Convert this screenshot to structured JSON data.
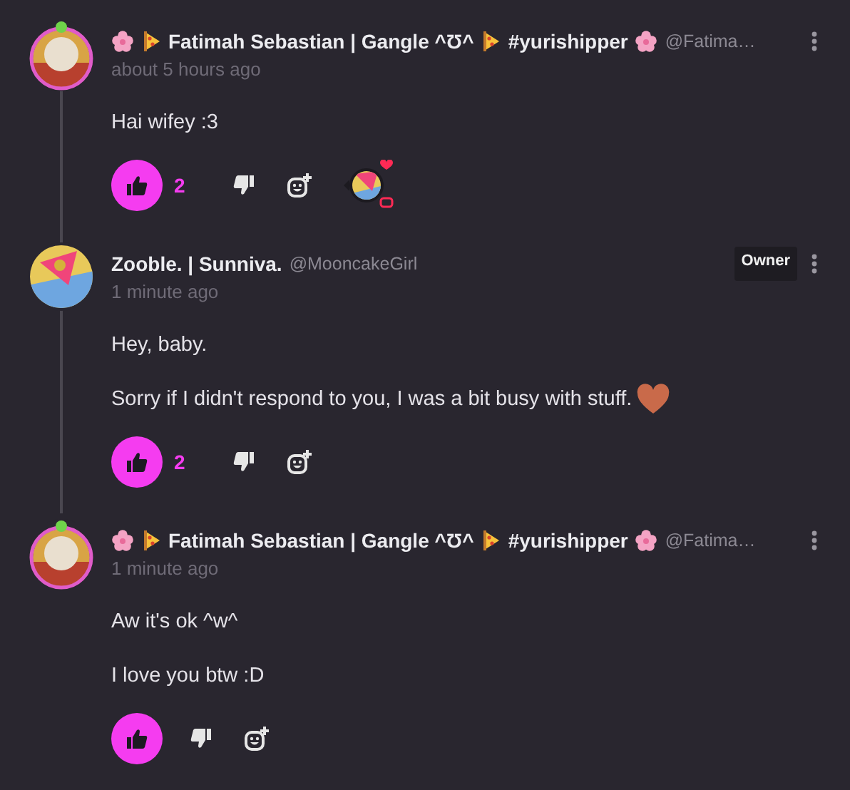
{
  "comments": [
    {
      "author": {
        "name": "Fatimah Sebastian | Gangle ^Ʊ^",
        "tag": "#yurishipper",
        "handle": "@Fatima…",
        "decorated": true,
        "avatar_frame": true
      },
      "time": "about 5 hours ago",
      "paragraphs": [
        {
          "text": "Hai wifey :3",
          "ends_with_heart": false
        }
      ],
      "liked": true,
      "likes": "2",
      "creator_hearted": true
    },
    {
      "author": {
        "name": "Zooble. | Sunniva.",
        "handle": "@MooncakeGirl",
        "decorated": false,
        "avatar_frame": false
      },
      "time": "1 minute ago",
      "owner_badge": "Owner",
      "paragraphs": [
        {
          "text": "Hey, baby.",
          "ends_with_heart": false
        },
        {
          "text": "Sorry if I didn't respond to you, I was a bit busy with stuff.",
          "ends_with_heart": true
        }
      ],
      "liked": true,
      "likes": "2",
      "creator_hearted": false
    },
    {
      "author": {
        "name": "Fatimah Sebastian | Gangle ^Ʊ^",
        "tag": "#yurishipper",
        "handle": "@Fatima…",
        "decorated": true,
        "avatar_frame": true
      },
      "time": "1 minute ago",
      "paragraphs": [
        {
          "text": "Aw it's ok ^w^",
          "ends_with_heart": false
        },
        {
          "text": "I love you btw :D",
          "ends_with_heart": false
        }
      ],
      "liked": true,
      "creator_hearted": false
    }
  ]
}
